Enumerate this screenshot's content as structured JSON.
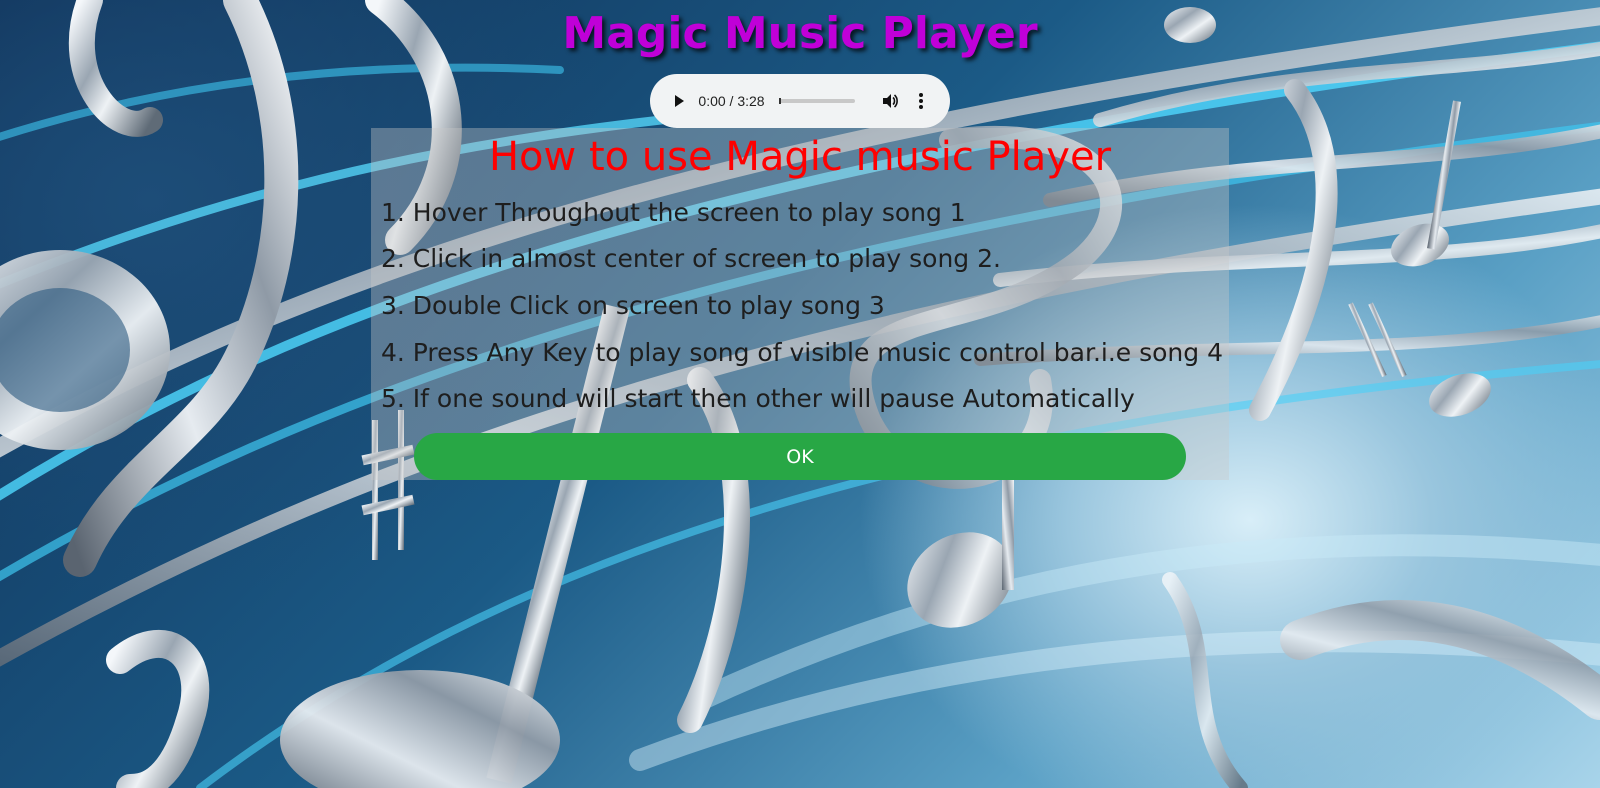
{
  "page": {
    "title": "Magic Music Player",
    "title_color": "#c000d8"
  },
  "audio_player": {
    "current_time": "0:00",
    "separator": " / ",
    "duration": "3:28",
    "progress": 0,
    "play_icon": "play-icon",
    "volume_icon": "volume-icon",
    "more_icon": "more-vertical-icon"
  },
  "instructions": {
    "heading": "How to use Magic music Player",
    "heading_color": "#ff0000",
    "steps": [
      "1. Hover Throughout the screen to play song 1",
      "2. Click in almost center of screen to play song 2.",
      "3. Double Click on screen to play song 3",
      "4. Press Any Key to play song of visible music control bar.i.e song 4",
      "5. If one sound will start then other will pause Automatically"
    ],
    "ok_label": "OK",
    "ok_color": "#28a745"
  }
}
